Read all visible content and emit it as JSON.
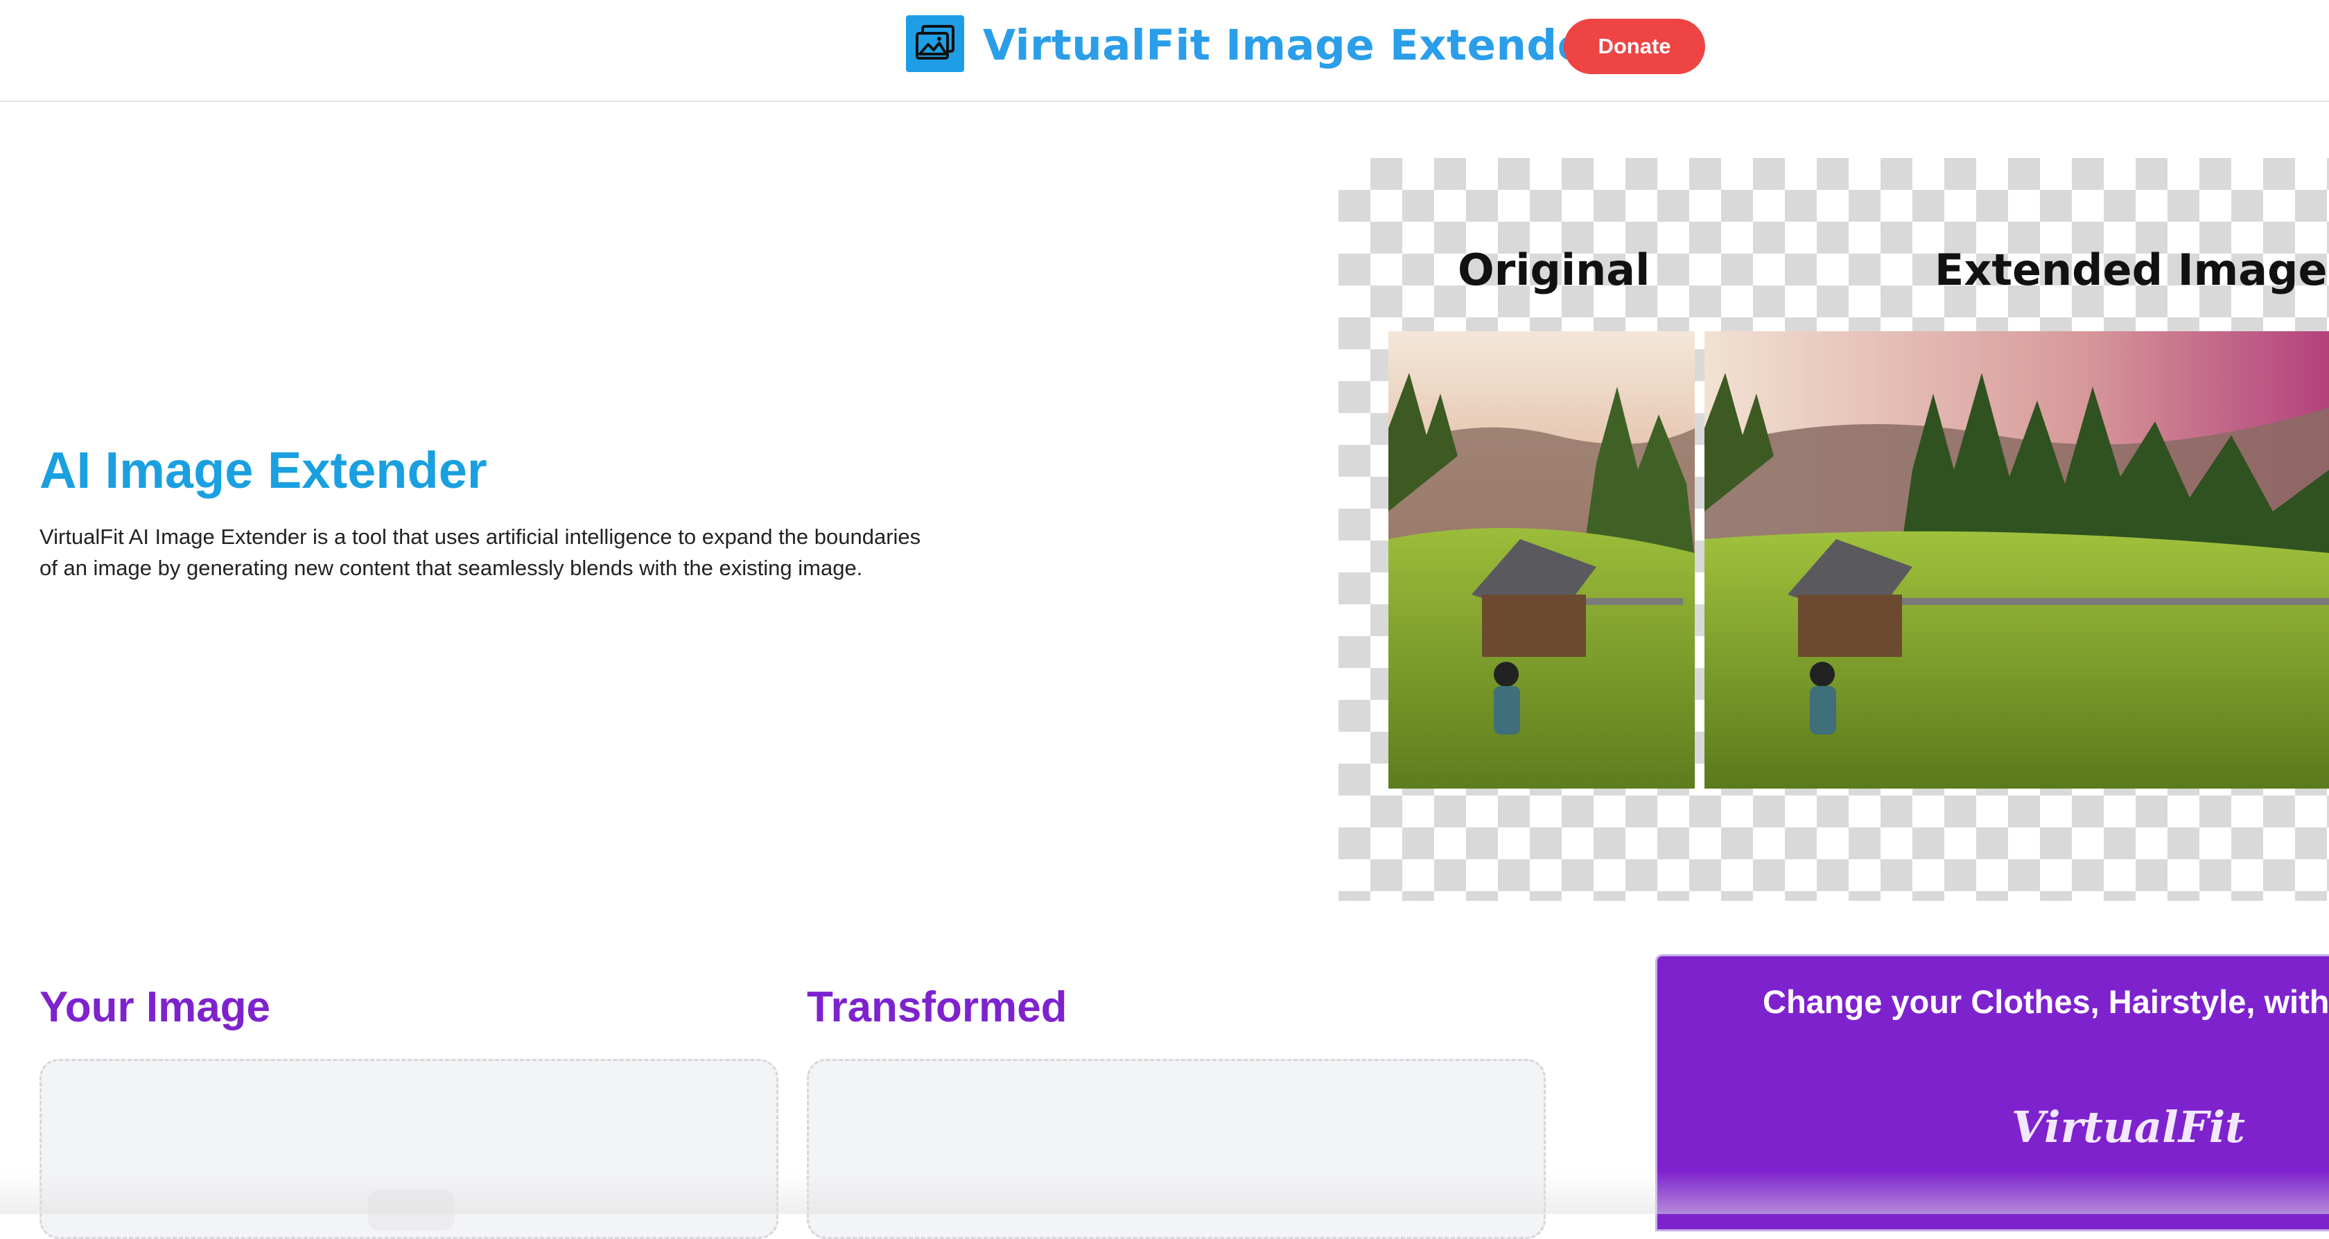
{
  "header": {
    "title": "VirtualFit Image Extender",
    "donate_label": "Donate",
    "logo_icon": "image-icon",
    "colors": {
      "title": "#2b9ee9",
      "icon_bg": "#1e9ee6",
      "donate": "#ef4444"
    }
  },
  "hero": {
    "title": "AI Image Extender",
    "description": "VirtualFit AI Image Extender is a tool that uses artificial intelligence to expand the boundaries of an image by generating new content that seamlessly blends with the existing image."
  },
  "demo": {
    "original_label": "Original",
    "extended_label": "Extended Image"
  },
  "upload": {
    "your_image_title": "Your Image",
    "transformed_title": "Transformed"
  },
  "promo": {
    "text": "Change your Clothes, Hairstyle, within",
    "logo_text": "VirtualFit",
    "color": "#7e22ce"
  }
}
